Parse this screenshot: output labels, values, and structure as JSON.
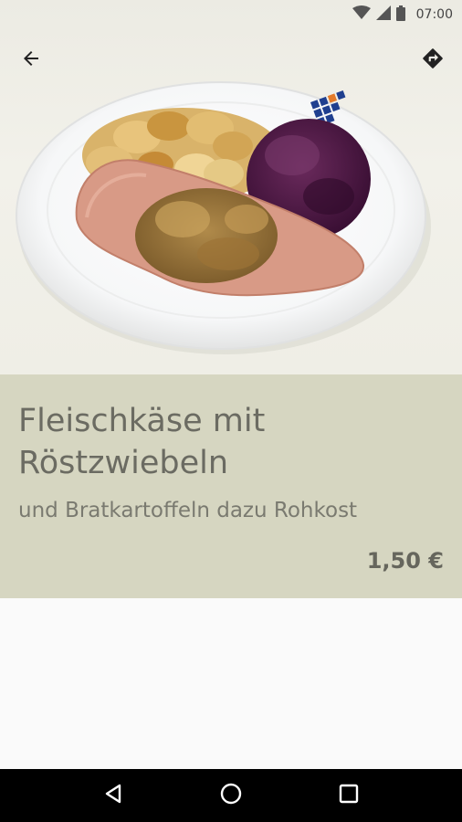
{
  "status_bar": {
    "time": "07:00",
    "icons": [
      "wifi-icon",
      "cell-signal-icon",
      "battery-icon"
    ]
  },
  "toolbar": {
    "back_icon": "arrow-left-icon",
    "directions_icon": "directions-icon"
  },
  "dish": {
    "title": "Fleischkäse mit Röstzwiebeln",
    "description": "und Bratkartoffeln dazu Rohkost",
    "price": "1,50 €"
  },
  "navigation_bar": {
    "icons": [
      "back-triangle-icon",
      "home-circle-icon",
      "recents-square-icon"
    ]
  },
  "colors": {
    "info_background": "#d6d6c1",
    "title_text": "#6b6b62",
    "nav_background": "#000000"
  }
}
